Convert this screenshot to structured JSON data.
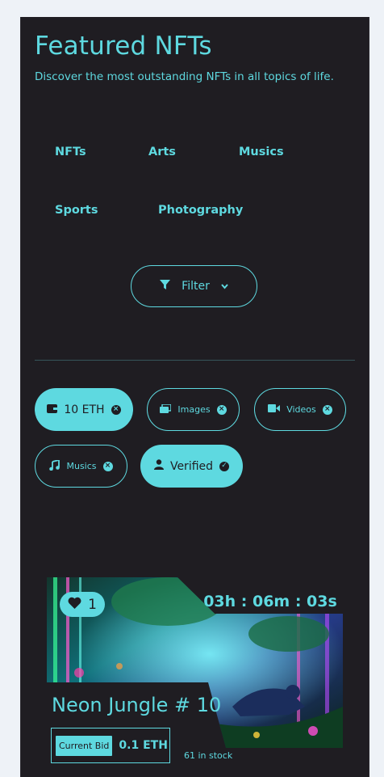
{
  "header": {
    "title": "Featured NFTs",
    "subtitle": "Discover the most outstanding NFTs in all topics of life."
  },
  "categories": [
    "NFTs",
    "Arts",
    "Musics",
    "Sports",
    "Photography"
  ],
  "filter_button": {
    "label": "Filter"
  },
  "chips": [
    {
      "label": "10 ETH",
      "icon": "wallet-icon",
      "active": true
    },
    {
      "label": "Images",
      "icon": "images-icon",
      "active": false
    },
    {
      "label": "Videos",
      "icon": "video-icon",
      "active": false
    },
    {
      "label": "Musics",
      "icon": "music-note-icon",
      "active": false
    },
    {
      "label": "Verified",
      "icon": "user-icon",
      "active": true
    }
  ],
  "card": {
    "likes": "1",
    "countdown": "03h : 06m : 03s",
    "title": "Neon Jungle # 10",
    "bid_label": "Current Bid",
    "bid_value": "0.1 ETH",
    "stock": "61 in stock"
  },
  "colors": {
    "accent": "#5ed9e0",
    "background": "#1f1d22",
    "page": "#eef2f7"
  }
}
